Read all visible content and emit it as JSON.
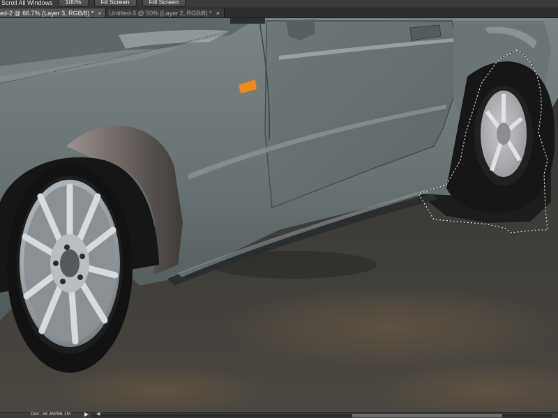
{
  "options_bar": {
    "scroll_all_windows_label": "Scroll All Windows",
    "scroll_all_windows_checked": true,
    "zoom_100_label": "100%",
    "fit_screen_label": "Fit Screen",
    "fill_screen_label": "Fill Screen"
  },
  "tabs": [
    {
      "label": "ed-2 @ 66.7% (Layer 3, RGB/8) *",
      "active": true,
      "close": "×"
    },
    {
      "label": "Untitled-3 @ 50% (Layer 2, RGB/8) *",
      "active": false,
      "close": "×"
    }
  ],
  "status": {
    "doc_size": "Doc: 34.3M/98.1M",
    "menu_arrow": "▶",
    "scroll_left_arrow": "◀"
  },
  "colors": {
    "car_body": "#6f7a7b",
    "ground": "#3f3f3c",
    "turn_signal": "#f08a14",
    "ui_panel": "#3a3a3a"
  }
}
